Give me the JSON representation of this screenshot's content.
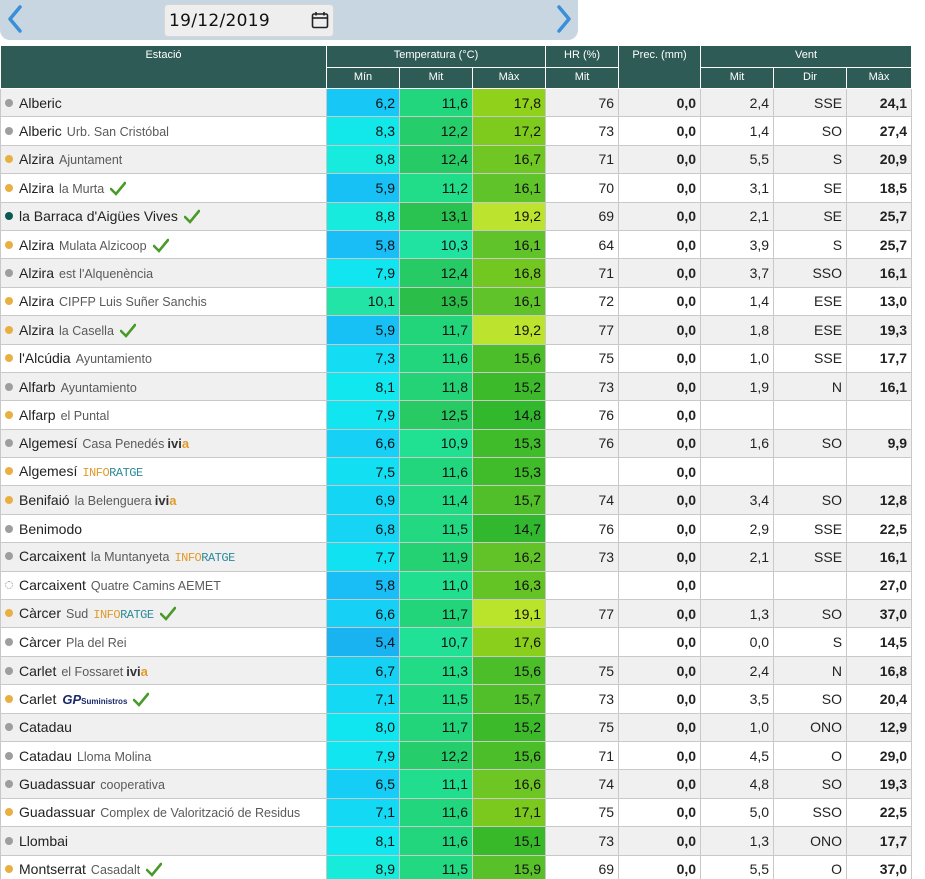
{
  "header": {
    "date": "19/12/2019",
    "prev_icon": "chevron-left-icon",
    "next_icon": "chevron-right-icon",
    "calendar_icon": "calendar-icon"
  },
  "columns": {
    "station": "Estació",
    "temp_group": "Temperatura (°C)",
    "hr_group": "HR (%)",
    "prec_group": "Prec. (mm)",
    "wind_group": "Vent",
    "t_min": "Mín",
    "t_mit": "Mit",
    "t_max": "Màx",
    "hr_mit": "Mit",
    "w_mit": "Mit",
    "w_dir": "Dir",
    "w_max": "Màx"
  },
  "colors": {
    "header_bg": "#2f5b56",
    "dot_gray": "#9e9e9e",
    "dot_orange": "#e8b040",
    "dot_teal": "#0b5a52",
    "check_green": "#4a9a2a"
  },
  "rows": [
    {
      "name": "Alberic",
      "sub": "",
      "dot": "gray",
      "logo": "",
      "check": false,
      "tmin": "6,2",
      "tmit": "11,6",
      "tmax": "17,8",
      "hr": "76",
      "prec": "0,0",
      "wmit": "2,4",
      "wdir": "SSE",
      "wmax": "24,1"
    },
    {
      "name": "Alberic",
      "sub": "Urb. San Cristóbal",
      "dot": "gray",
      "logo": "",
      "check": false,
      "tmin": "8,3",
      "tmit": "12,2",
      "tmax": "17,2",
      "hr": "73",
      "prec": "0,0",
      "wmit": "1,4",
      "wdir": "SO",
      "wmax": "27,4"
    },
    {
      "name": "Alzira",
      "sub": "Ajuntament",
      "dot": "orange",
      "logo": "",
      "check": false,
      "tmin": "8,8",
      "tmit": "12,4",
      "tmax": "16,7",
      "hr": "71",
      "prec": "0,0",
      "wmit": "5,5",
      "wdir": "S",
      "wmax": "20,9"
    },
    {
      "name": "Alzira",
      "sub": "la Murta",
      "dot": "orange",
      "logo": "",
      "check": true,
      "tmin": "5,9",
      "tmit": "11,2",
      "tmax": "16,1",
      "hr": "70",
      "prec": "0,0",
      "wmit": "3,1",
      "wdir": "SE",
      "wmax": "18,5"
    },
    {
      "name": "la Barraca d'Aigües Vives",
      "sub": "",
      "dot": "teal",
      "logo": "",
      "check": true,
      "tmin": "8,8",
      "tmit": "13,1",
      "tmax": "19,2",
      "hr": "69",
      "prec": "0,0",
      "wmit": "2,1",
      "wdir": "SE",
      "wmax": "25,7"
    },
    {
      "name": "Alzira",
      "sub": "Mulata Alzicoop",
      "dot": "orange",
      "logo": "",
      "check": true,
      "tmin": "5,8",
      "tmit": "10,3",
      "tmax": "16,1",
      "hr": "64",
      "prec": "0,0",
      "wmit": "3,9",
      "wdir": "S",
      "wmax": "25,7"
    },
    {
      "name": "Alzira",
      "sub": "est l'Alquenència",
      "dot": "gray",
      "logo": "",
      "check": false,
      "tmin": "7,9",
      "tmit": "12,4",
      "tmax": "16,8",
      "hr": "71",
      "prec": "0,0",
      "wmit": "3,7",
      "wdir": "SSO",
      "wmax": "16,1"
    },
    {
      "name": "Alzira",
      "sub": "CIPFP Luis Suñer Sanchis",
      "dot": "orange",
      "logo": "",
      "check": false,
      "tmin": "10,1",
      "tmit": "13,5",
      "tmax": "16,1",
      "hr": "72",
      "prec": "0,0",
      "wmit": "1,4",
      "wdir": "ESE",
      "wmax": "13,0"
    },
    {
      "name": "Alzira",
      "sub": "la Casella",
      "dot": "orange",
      "logo": "",
      "check": true,
      "tmin": "5,9",
      "tmit": "11,7",
      "tmax": "19,2",
      "hr": "77",
      "prec": "0,0",
      "wmit": "1,8",
      "wdir": "ESE",
      "wmax": "19,3"
    },
    {
      "name": "l'Alcúdia",
      "sub": "Ayuntamiento",
      "dot": "orange",
      "logo": "",
      "check": false,
      "tmin": "7,3",
      "tmit": "11,6",
      "tmax": "15,6",
      "hr": "75",
      "prec": "0,0",
      "wmit": "1,0",
      "wdir": "SSE",
      "wmax": "17,7"
    },
    {
      "name": "Alfarb",
      "sub": "Ayuntamiento",
      "dot": "gray",
      "logo": "",
      "check": false,
      "tmin": "8,1",
      "tmit": "11,8",
      "tmax": "15,2",
      "hr": "73",
      "prec": "0,0",
      "wmit": "1,9",
      "wdir": "N",
      "wmax": "16,1"
    },
    {
      "name": "Alfarp",
      "sub": "el Puntal",
      "dot": "orange",
      "logo": "",
      "check": false,
      "tmin": "7,9",
      "tmit": "12,5",
      "tmax": "14,8",
      "hr": "76",
      "prec": "0,0",
      "wmit": "",
      "wdir": "",
      "wmax": ""
    },
    {
      "name": "Algemesí",
      "sub": "Casa Penedés",
      "dot": "gray",
      "logo": "ivia",
      "check": false,
      "tmin": "6,6",
      "tmit": "10,9",
      "tmax": "15,3",
      "hr": "76",
      "prec": "0,0",
      "wmit": "1,6",
      "wdir": "SO",
      "wmax": "9,9"
    },
    {
      "name": "Algemesí",
      "sub": "",
      "dot": "orange",
      "logo": "inforatge",
      "check": false,
      "tmin": "7,5",
      "tmit": "11,6",
      "tmax": "15,3",
      "hr": "",
      "prec": "0,0",
      "wmit": "",
      "wdir": "",
      "wmax": ""
    },
    {
      "name": "Benifaió",
      "sub": "la Belenguera",
      "dot": "orange",
      "logo": "ivia",
      "check": false,
      "tmin": "6,9",
      "tmit": "11,4",
      "tmax": "15,7",
      "hr": "74",
      "prec": "0,0",
      "wmit": "3,4",
      "wdir": "SO",
      "wmax": "12,8"
    },
    {
      "name": "Benimodo",
      "sub": "",
      "dot": "gray",
      "logo": "",
      "check": false,
      "tmin": "6,8",
      "tmit": "11,5",
      "tmax": "14,7",
      "hr": "76",
      "prec": "0,0",
      "wmit": "2,9",
      "wdir": "SSE",
      "wmax": "22,5"
    },
    {
      "name": "Carcaixent",
      "sub": "la Muntanyeta",
      "dot": "gray",
      "logo": "inforatge",
      "check": false,
      "tmin": "7,7",
      "tmit": "11,9",
      "tmax": "16,2",
      "hr": "73",
      "prec": "0,0",
      "wmit": "2,1",
      "wdir": "SSE",
      "wmax": "16,1"
    },
    {
      "name": "Carcaixent",
      "sub": "Quatre Camins AEMET",
      "dot": "empty",
      "logo": "",
      "check": false,
      "tmin": "5,8",
      "tmit": "11,0",
      "tmax": "16,3",
      "hr": "",
      "prec": "0,0",
      "wmit": "",
      "wdir": "",
      "wmax": "27,0"
    },
    {
      "name": "Càrcer",
      "sub": "Sud",
      "dot": "orange",
      "logo": "inforatge",
      "check": true,
      "tmin": "6,6",
      "tmit": "11,7",
      "tmax": "19,1",
      "hr": "77",
      "prec": "0,0",
      "wmit": "1,3",
      "wdir": "SO",
      "wmax": "37,0"
    },
    {
      "name": "Càrcer",
      "sub": "Pla del Rei",
      "dot": "gray",
      "logo": "",
      "check": false,
      "tmin": "5,4",
      "tmit": "10,7",
      "tmax": "17,6",
      "hr": "",
      "prec": "0,0",
      "wmit": "0,0",
      "wdir": "S",
      "wmax": "14,5"
    },
    {
      "name": "Carlet",
      "sub": "el Fossaret",
      "dot": "gray",
      "logo": "ivia",
      "check": false,
      "tmin": "6,7",
      "tmit": "11,3",
      "tmax": "15,6",
      "hr": "75",
      "prec": "0,0",
      "wmit": "2,4",
      "wdir": "N",
      "wmax": "16,8"
    },
    {
      "name": "Carlet",
      "sub": "",
      "dot": "orange",
      "logo": "gp",
      "check": true,
      "tmin": "7,1",
      "tmit": "11,5",
      "tmax": "15,7",
      "hr": "73",
      "prec": "0,0",
      "wmit": "3,5",
      "wdir": "SO",
      "wmax": "20,4"
    },
    {
      "name": "Catadau",
      "sub": "",
      "dot": "gray",
      "logo": "",
      "check": false,
      "tmin": "8,0",
      "tmit": "11,7",
      "tmax": "15,2",
      "hr": "75",
      "prec": "0,0",
      "wmit": "1,0",
      "wdir": "ONO",
      "wmax": "12,9"
    },
    {
      "name": "Catadau",
      "sub": "Lloma Molina",
      "dot": "gray",
      "logo": "",
      "check": false,
      "tmin": "7,9",
      "tmit": "12,2",
      "tmax": "15,6",
      "hr": "71",
      "prec": "0,0",
      "wmit": "4,5",
      "wdir": "O",
      "wmax": "29,0"
    },
    {
      "name": "Guadassuar",
      "sub": "cooperativa",
      "dot": "gray",
      "logo": "",
      "check": false,
      "tmin": "6,5",
      "tmit": "11,1",
      "tmax": "16,6",
      "hr": "74",
      "prec": "0,0",
      "wmit": "4,8",
      "wdir": "SO",
      "wmax": "19,3"
    },
    {
      "name": "Guadassuar",
      "sub": "Complex de Valorització de Residus",
      "dot": "orange",
      "logo": "",
      "check": false,
      "tmin": "7,1",
      "tmit": "11,6",
      "tmax": "17,1",
      "hr": "75",
      "prec": "0,0",
      "wmit": "5,0",
      "wdir": "SSO",
      "wmax": "22,5"
    },
    {
      "name": "Llombai",
      "sub": "",
      "dot": "gray",
      "logo": "",
      "check": false,
      "tmin": "8,1",
      "tmit": "11,6",
      "tmax": "15,1",
      "hr": "73",
      "prec": "0,0",
      "wmit": "1,3",
      "wdir": "ONO",
      "wmax": "17,7"
    },
    {
      "name": "Montserrat",
      "sub": "Casadalt",
      "dot": "orange",
      "logo": "",
      "check": true,
      "tmin": "8,9",
      "tmit": "11,5",
      "tmax": "15,9",
      "hr": "69",
      "prec": "0,0",
      "wmit": "5,5",
      "wdir": "O",
      "wmax": "37,0"
    }
  ],
  "logos": {
    "ivia": [
      "iv",
      "i",
      "a"
    ],
    "inforatge": [
      "INFO",
      "RATGE"
    ],
    "gp": [
      "GP",
      "Suministros"
    ]
  }
}
